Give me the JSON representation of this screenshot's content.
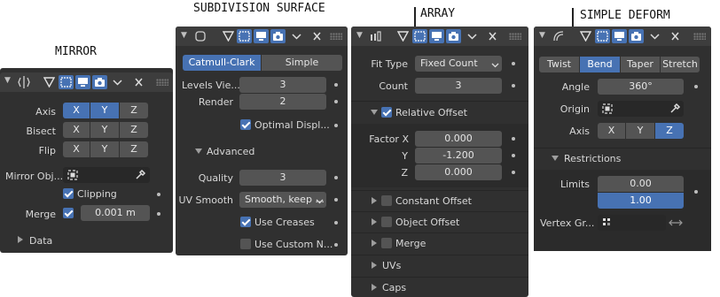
{
  "titles": {
    "mirror": "MIRROR",
    "subdivision": "SUBDIVISION SURFACE",
    "array": "ARRAY",
    "simple_deform": "SIMPLE DEFORM"
  },
  "header_icons": [
    "modifier-type-icon",
    "edit-mode-cage-icon",
    "edit-mode-icon",
    "realtime-display-icon",
    "render-icon",
    "chevron-down-icon",
    "close-icon"
  ],
  "mirror": {
    "axis": {
      "label": "Axis",
      "x": "X",
      "y": "Y",
      "z": "Z",
      "x_on": true,
      "y_on": true,
      "z_on": false
    },
    "bisect": {
      "label": "Bisect",
      "x": "X",
      "y": "Y",
      "z": "Z"
    },
    "flip": {
      "label": "Flip",
      "x": "X",
      "y": "Y",
      "z": "Z"
    },
    "mirror_object": {
      "label": "Mirror Obj...",
      "value": ""
    },
    "clipping": {
      "label": "Clipping",
      "checked": true
    },
    "merge": {
      "label": "Merge",
      "checked": true,
      "value": "0.001 m"
    },
    "data": {
      "label": "Data"
    }
  },
  "subdivision": {
    "tabs": {
      "catmull_clark": "Catmull-Clark",
      "simple": "Simple"
    },
    "levels_viewport": {
      "label": "Levels Vie...",
      "value": "3"
    },
    "render": {
      "label": "Render",
      "value": "2"
    },
    "optimal_display": {
      "label": "Optimal Displ...",
      "checked": true
    },
    "advanced": {
      "label": "Advanced"
    },
    "quality": {
      "label": "Quality",
      "value": "3"
    },
    "uv_smooth": {
      "label": "UV Smooth",
      "value": "Smooth, keep ..."
    },
    "use_creases": {
      "label": "Use Creases",
      "checked": true
    },
    "use_custom_normals": {
      "label": "Use Custom N...",
      "checked": false
    }
  },
  "array": {
    "fit_type": {
      "label": "Fit Type",
      "value": "Fixed Count"
    },
    "count": {
      "label": "Count",
      "value": "3"
    },
    "relative_offset": {
      "label": "Relative Offset",
      "checked": true
    },
    "factor_x": {
      "label": "Factor X",
      "value": "0.000"
    },
    "factor_y": {
      "label": "Y",
      "value": "-1.200"
    },
    "factor_z": {
      "label": "Z",
      "value": "0.000"
    },
    "constant_offset": {
      "label": "Constant Offset",
      "checked": false
    },
    "object_offset": {
      "label": "Object Offset",
      "checked": false
    },
    "merge": {
      "label": "Merge",
      "checked": false
    },
    "uvs": {
      "label": "UVs"
    },
    "caps": {
      "label": "Caps"
    }
  },
  "simple_deform": {
    "tabs": {
      "twist": "Twist",
      "bend": "Bend",
      "taper": "Taper",
      "stretch": "Stretch",
      "active": "bend"
    },
    "angle": {
      "label": "Angle",
      "value": "360°"
    },
    "origin": {
      "label": "Origin",
      "value": ""
    },
    "axis": {
      "label": "Axis",
      "x": "X",
      "y": "Y",
      "z": "Z",
      "active": "z"
    },
    "restrictions": {
      "label": "Restrictions"
    },
    "limits": {
      "label": "Limits",
      "min": "0.00",
      "max": "1.00"
    },
    "vertex_group": {
      "label": "Vertex Gr...",
      "value": ""
    }
  },
  "colors": {
    "panel": "#303030",
    "header": "#3d3d3d",
    "field": "#545454",
    "active": "#4772b3"
  }
}
